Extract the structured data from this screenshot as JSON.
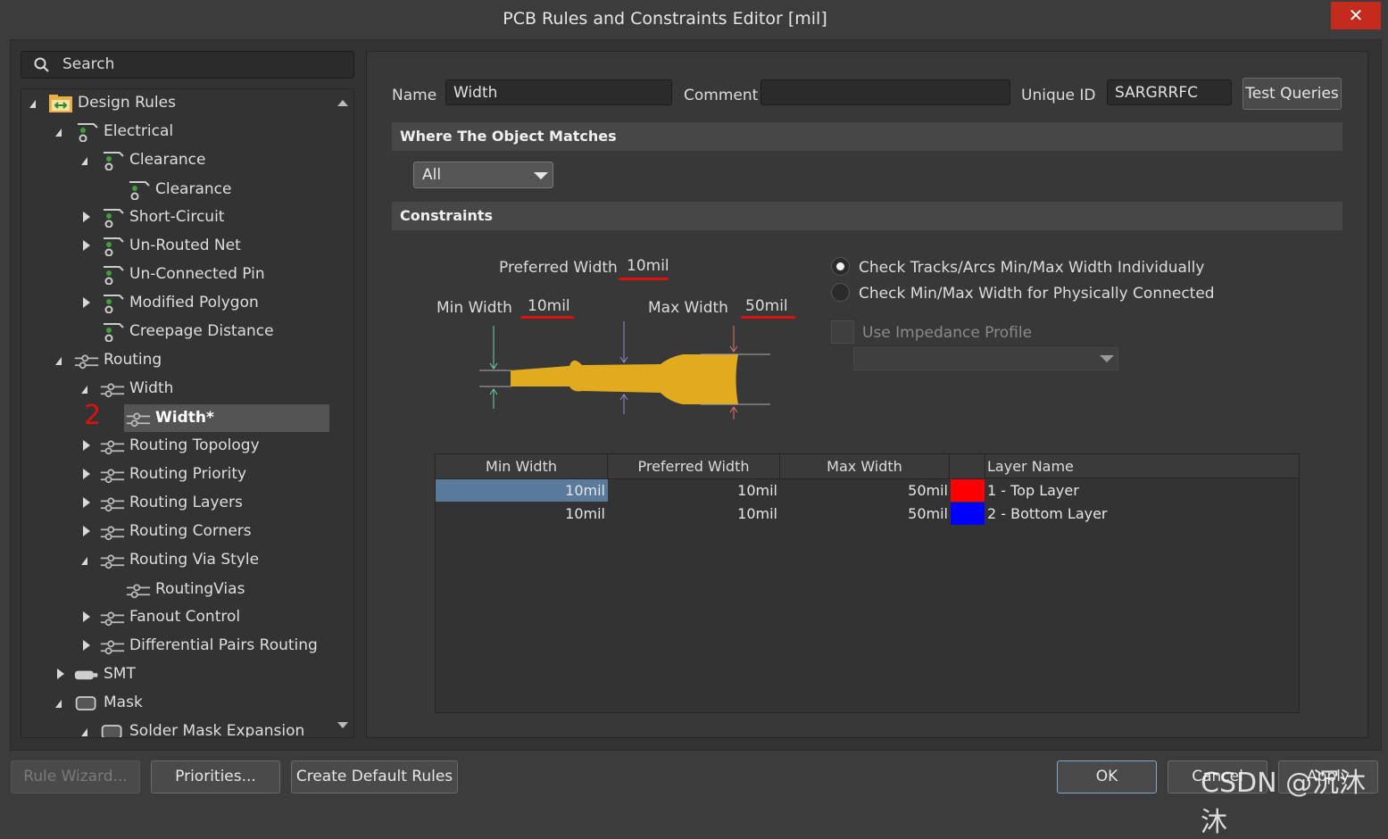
{
  "window": {
    "title": "PCB Rules and Constraints Editor [mil]",
    "close_glyph": "✕"
  },
  "search": {
    "placeholder": "Search"
  },
  "tree": {
    "items": [
      {
        "label": "Design Rules"
      },
      {
        "label": "Electrical"
      },
      {
        "label": "Clearance"
      },
      {
        "label": "Clearance"
      },
      {
        "label": "Short-Circuit"
      },
      {
        "label": "Un-Routed Net"
      },
      {
        "label": "Un-Connected Pin"
      },
      {
        "label": "Modified Polygon"
      },
      {
        "label": "Creepage Distance"
      },
      {
        "label": "Routing"
      },
      {
        "label": "Width"
      },
      {
        "label": "Width*",
        "selected": true
      },
      {
        "label": "Routing Topology"
      },
      {
        "label": "Routing Priority"
      },
      {
        "label": "Routing Layers"
      },
      {
        "label": "Routing Corners"
      },
      {
        "label": "Routing Via Style"
      },
      {
        "label": "RoutingVias"
      },
      {
        "label": "Fanout Control"
      },
      {
        "label": "Differential Pairs Routing"
      },
      {
        "label": "SMT"
      },
      {
        "label": "Mask"
      },
      {
        "label": "Solder Mask Expansion"
      }
    ],
    "annotation": "2"
  },
  "rule": {
    "name_label": "Name",
    "name_value": "Width",
    "comment_label": "Comment",
    "comment_value": "",
    "uid_label": "Unique ID",
    "uid_value": "SARGRRFC",
    "test_queries": "Test Queries"
  },
  "where": {
    "header": "Where The Object Matches",
    "selected": "All"
  },
  "constraints": {
    "header": "Constraints",
    "preferred_label": "Preferred Width",
    "preferred_value": "10mil",
    "min_label": "Min Width",
    "min_value": "10mil",
    "max_label": "Max Width",
    "max_value": "50mil",
    "radio1": "Check Tracks/Arcs Min/Max Width Individually",
    "radio2": "Check Min/Max Width for Physically Connected",
    "impedance_label": "Use Impedance Profile"
  },
  "table": {
    "headers": [
      "Min Width",
      "Preferred Width",
      "Max Width",
      "Layer Name"
    ],
    "rows": [
      {
        "min": "10mil",
        "pref": "10mil",
        "max": "50mil",
        "color": "#ff0000",
        "layer": "1 - Top Layer"
      },
      {
        "min": "10mil",
        "pref": "10mil",
        "max": "50mil",
        "color": "#0000ff",
        "layer": "2 - Bottom Layer"
      }
    ]
  },
  "buttons": {
    "rule_wizard": "Rule Wizard...",
    "priorities": "Priorities...",
    "create_default": "Create Default Rules",
    "ok": "OK",
    "cancel": "Cancel",
    "apply": "Apply"
  },
  "watermark": "CSDN @沉沐沐",
  "colors": {
    "accent_yellow": "#e2aa1e",
    "selection_blue": "#5a7a9c",
    "close_red": "#c42b1c",
    "annotation_red": "#e01010"
  }
}
